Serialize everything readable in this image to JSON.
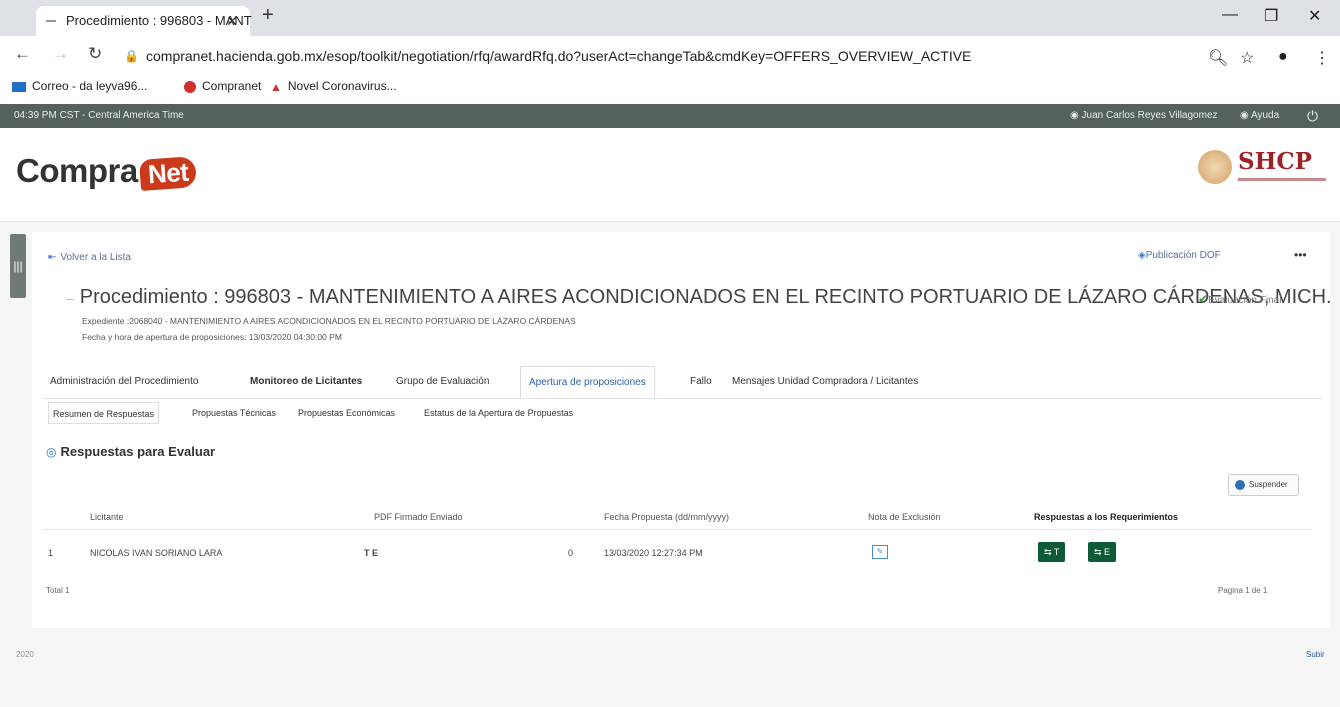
{
  "browser": {
    "tab_title": "Procedimiento : 996803 - MANT",
    "url": "compranet.hacienda.gob.mx/esop/toolkit/negotiation/rfq/awardRfq.do?userAct=changeTab&cmdKey=OFFERS_OVERVIEW_ACTIVE",
    "bookmarks": [
      "Correo - da leyva96...",
      "Compranet",
      "Novel Coronavirus..."
    ]
  },
  "header": {
    "time": "04:39 PM CST - Central America Time",
    "user": "Juan Carlos Reyes Villagomez",
    "help": "Ayuda"
  },
  "brand": {
    "logo_main": "Compra",
    "logo_net": "Net",
    "agency": "SHCP"
  },
  "toolbar": {
    "back": "Volver a la Lista",
    "publicacion": "Publicación DOF"
  },
  "procedure": {
    "title": "Procedimiento : 996803 - MANTENIMIENTO A AIRES ACONDICIONADOS EN EL RECINTO PORTUARIO DE LÁZARO CÁRDENAS, MICH.",
    "status": "Evaluación Final",
    "expediente": "Expediente :2068040 - MANTENIMIENTO A AIRES ACONDICIONADOS EN EL RECINTO PORTUARIO DE LÁZARO CÁRDENAS",
    "fecha": "Fecha y hora de apertura de proposiciones: 13/03/2020 04:30:00 PM"
  },
  "tabs": [
    "Administración del Procedimiento",
    "Monitoreo de Licitantes",
    "Grupo de Evaluación",
    "Apertura de proposiciones",
    "Fallo",
    "Mensajes Unidad Compradora / Licitantes"
  ],
  "subtabs": [
    "Resumen de Respuestas",
    "Propuestas Técnicas",
    "Propuestas Económicas",
    "Estatus de la Apertura de Propuestas"
  ],
  "section": {
    "title": "Respuestas para Evaluar",
    "suspend": "Suspender"
  },
  "table": {
    "headers": [
      "Licitante",
      "PDF Firmado Enviado",
      "Fecha Propuesta (dd/mm/yyyy)",
      "Nota de Exclusión",
      "Respuestas a los Requerimientos"
    ],
    "row": {
      "num": "1",
      "licitante": "NICOLAS IVAN SORIANO LARA",
      "pdf": "T E",
      "count": "0",
      "fecha": "13/03/2020 12:27:34 PM",
      "btn_t": "T",
      "btn_e": "E"
    },
    "total": "Total 1",
    "pagina": "Pagina 1 de 1"
  },
  "footer": {
    "year": "2020",
    "subir": "Subir"
  }
}
